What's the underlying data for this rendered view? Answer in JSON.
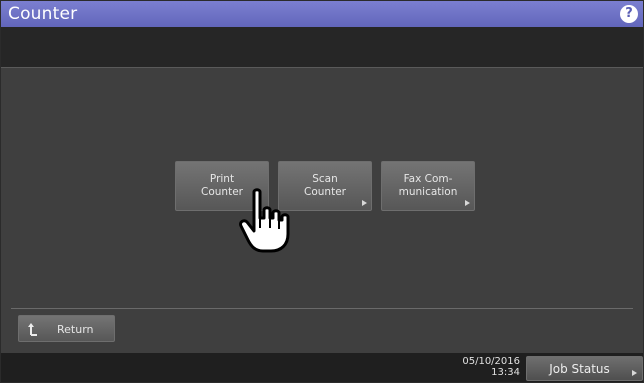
{
  "header": {
    "title": "Counter",
    "help_label": "?"
  },
  "functions": [
    {
      "line1": "Print",
      "line2": "Counter",
      "has_arrow": false
    },
    {
      "line1": "Scan",
      "line2": "Counter",
      "has_arrow": true
    },
    {
      "line1": "Fax Com-",
      "line2": "munication",
      "has_arrow": true
    }
  ],
  "navigation": {
    "return_label": "Return",
    "return_icon": "return-arrow-icon"
  },
  "footer": {
    "date": "05/10/2016",
    "time": "13:34",
    "job_status_label": "Job Status"
  },
  "overlay": {
    "pointer_icon": "pointing-hand-icon"
  },
  "colors": {
    "titlebar": "#6c70c4",
    "background": "#3f3f3f",
    "button": "#646464",
    "text": "#e6e6e6"
  }
}
